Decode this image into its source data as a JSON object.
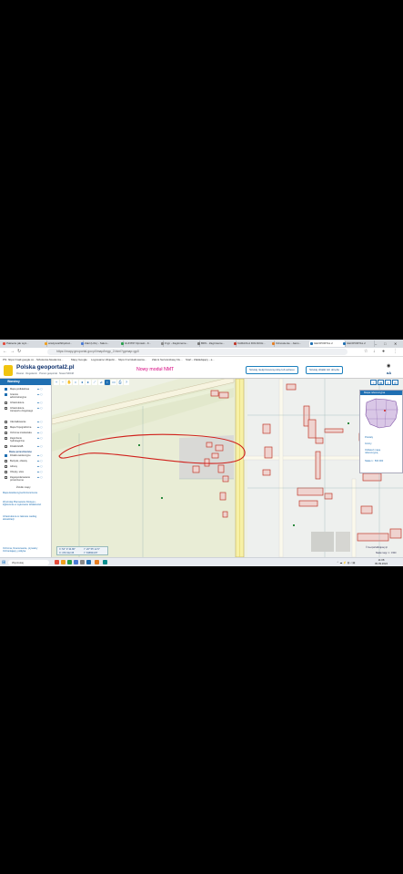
{
  "browser": {
    "tabs": [
      {
        "label": "Pakiecie jak wyś...",
        "color": "#e34b3b"
      },
      {
        "label": "wisdyscalhthpdsd...",
        "color": "#f0a020"
      },
      {
        "label": "Zakl (LOL) - Salon...",
        "color": "#4b7bd5"
      },
      {
        "label": "GUNTIP Opnieki - F...",
        "color": "#2aa14d"
      },
      {
        "label": "Fryp - Zagtmienie...",
        "color": "#888888"
      },
      {
        "label": "BDS - Zagtmienie...",
        "color": "#777777"
      },
      {
        "label": "KARAOLA DOLNICH...",
        "color": "#c0392b"
      },
      {
        "label": "Odnowienie - Jams...",
        "color": "#e67e22"
      },
      {
        "label": "GEOPORTAL 2",
        "color": "#1f6fb2"
      },
      {
        "label": "GEOPORTAL 2",
        "color": "#1f6fb2"
      }
    ],
    "url": "https://mapy.geoportal.gov.pl/imap/Imgp_2.html?gpmap=gp0",
    "bookmarks": [
      "PN: https://mail.google.co...",
      "Szkolenia Akademia...",
      "Mapy Google",
      "Logowanie Ubijecki...",
      "https://mcrslalinownia...",
      "Zakmi Serwisnikasy Du...",
      "Start - Zakładający - a..."
    ]
  },
  "site": {
    "title": "Polska geoportal2.pl",
    "links": "Rosnet  ·  Regulamin  ·  Pomoc geoportal  ·  Nowe ISDCM",
    "promo": "Nowy moduł NMT",
    "btn_check": "Szukaj niekprzesoną ulicę lub adresu",
    "btn_search": "Szukaj działki lub obrębu",
    "fontsize": "aA"
  },
  "sidebar": {
    "header": "Warstwy",
    "layers": [
      {
        "label": "Mapa podkładowa",
        "checked": true
      },
      {
        "label": "Granice administracyjne",
        "checked": true
      },
      {
        "label": "Infrastruktura",
        "checked": false
      },
      {
        "label": "Infrastruktura transportu drogowego",
        "checked": false
      },
      {
        "label": "Ukształtowanie",
        "checked": false
      },
      {
        "label": "Mapa Topograficzna",
        "checked": false
      },
      {
        "label": "Ochrona środowiska",
        "checked": false
      },
      {
        "label": "Zagrożenie hydrologiczne",
        "checked": false
      },
      {
        "label": "Działki EGiB",
        "checked": false
      }
    ],
    "group2": "Dane przestrzenne",
    "layers2": [
      {
        "label": "Działki ewidencyjne",
        "checked": true
      },
      {
        "label": "Budynki, obiekty",
        "checked": false
      },
      {
        "label": "Adresy",
        "checked": false
      },
      {
        "label": "Obręby, ulice",
        "checked": false
      },
      {
        "label": "Zagospodarowanie przestrzenne",
        "checked": false
      }
    ],
    "legend_title": "Źródło mapy",
    "legend_links": [
      "Mapa Ewidencyjna Rozszerzenie",
      "Wyszukaj Planowanie Dostępu - Zgłoszenie w wykonanie działalności",
      "Infrastruktura w zakresie według aktualizacji"
    ],
    "footer": "Ochrona, finansowanie, prywatny Ochraniający, polityka"
  },
  "map": {
    "coords": [
      "X: 52° 9' 34.86\"",
      "Y: 20° 55' 12.5\"",
      "X: 479 312.35",
      "Y: 636504.87"
    ],
    "overview_title": "Mapa referencyjna",
    "overview_opts": [
      "Powiaty",
      "Gminy",
      "Odśwież mapę referencyjną",
      "Skala 1 : 500 000"
    ],
    "attribution": "© GeoportalKrajowy.pl",
    "scale": "Skala mapy: 1 : 1500"
  },
  "taskbar": {
    "search": "Wyszukaj",
    "time": "11:08",
    "date": "09.09.2024"
  }
}
